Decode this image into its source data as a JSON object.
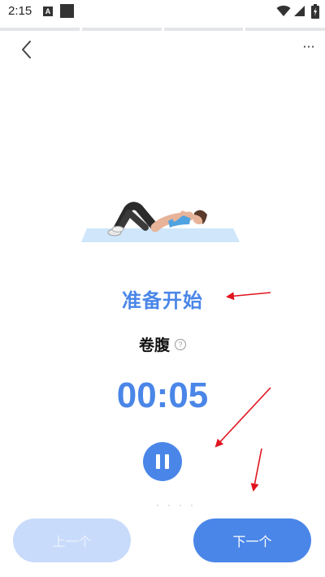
{
  "status_bar": {
    "time": "2:15",
    "notification_letter": "A"
  },
  "header": {
    "back_icon": "chevron-left-icon",
    "more_label": "···"
  },
  "progress_segments": 4,
  "illustration": {
    "icon": "crunch-exercise-illustration"
  },
  "workout": {
    "status_title": "准备开始",
    "exercise_name": "卷腹",
    "help_icon": "?",
    "timer": "00:05"
  },
  "controls": {
    "pause_icon": "pause-icon",
    "prev_label": "上一个",
    "next_label": "下一个"
  },
  "colors": {
    "accent": "#4a86e8",
    "accent_light": "#c9dbfb",
    "mat": "#cfe6fb",
    "annotation_red": "#e0141e"
  }
}
